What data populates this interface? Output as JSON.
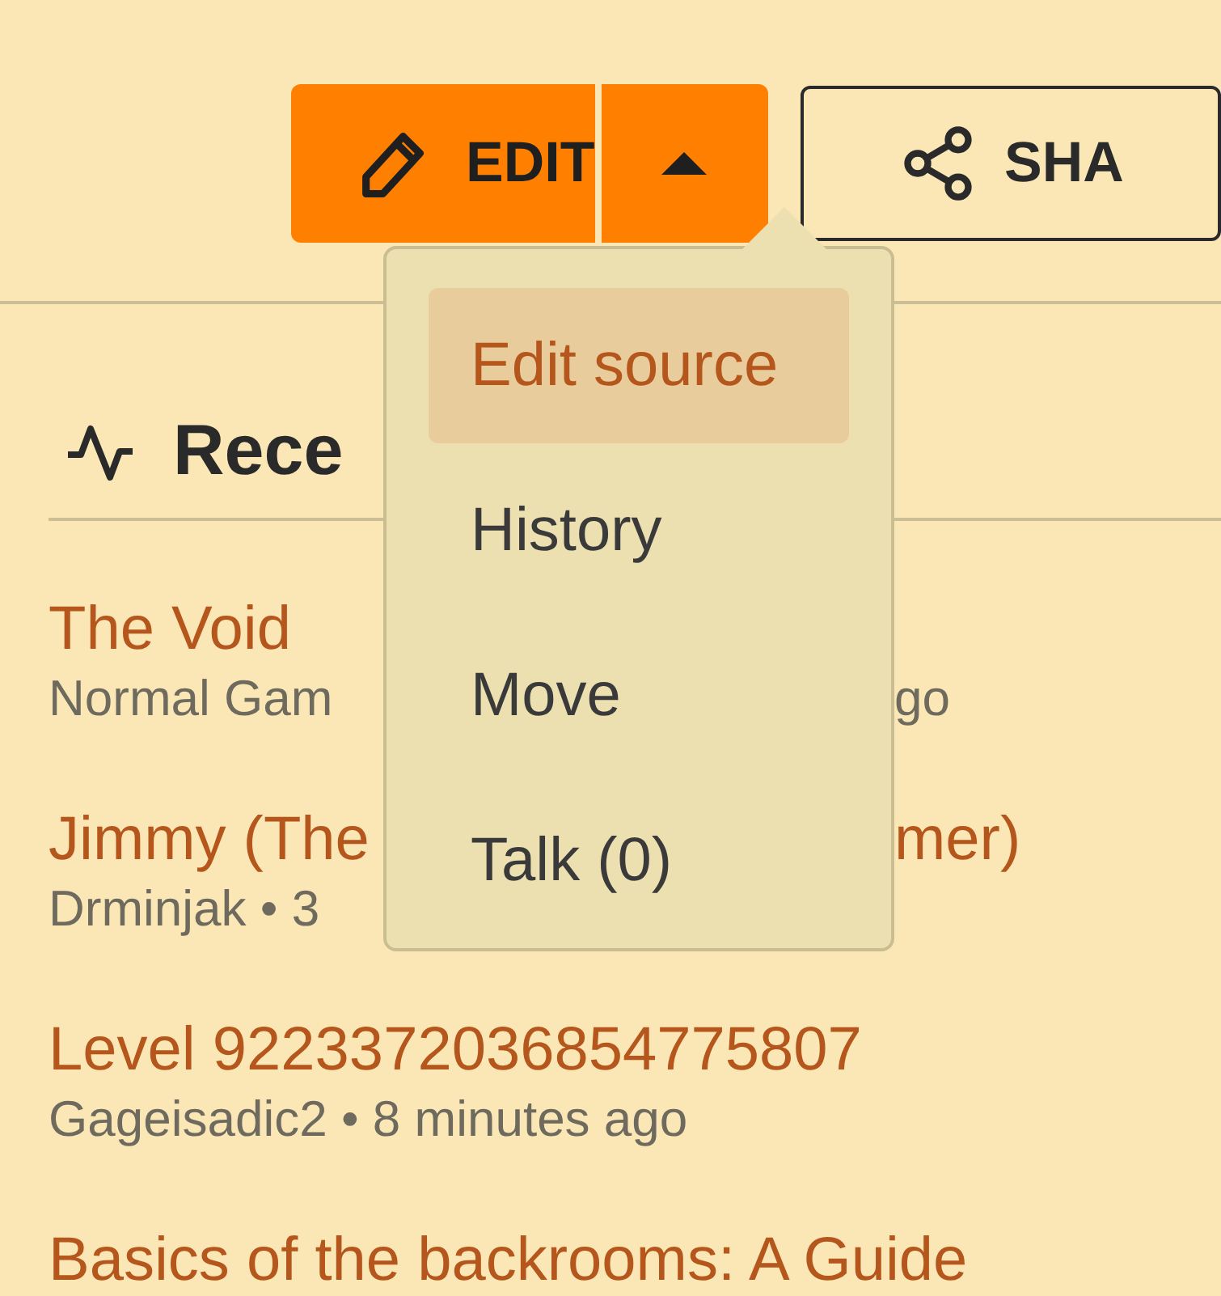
{
  "actions": {
    "edit_button": {
      "label": "EDIT"
    },
    "dropdown_toggle": {
      "expanded": true
    },
    "share_button": {
      "label": "SHA"
    }
  },
  "dropdown_menu": [
    {
      "label": "Edit source",
      "selected": true
    },
    {
      "label": "History",
      "selected": false
    },
    {
      "label": "Move",
      "selected": false
    },
    {
      "label": "Talk (0)",
      "selected": false
    }
  ],
  "recent_changes": {
    "title": "Rece",
    "items": [
      {
        "title": "The Void",
        "meta": "Normal Gam",
        "meta_right": "go"
      },
      {
        "title": "Jimmy (The",
        "title_right": "mer)",
        "meta": "Drminjak • 3"
      },
      {
        "title": "Level 9223372036854775807",
        "meta": "Gageisadic2 • 8 minutes ago"
      },
      {
        "title": "Basics of the backrooms: A Guide"
      }
    ]
  }
}
